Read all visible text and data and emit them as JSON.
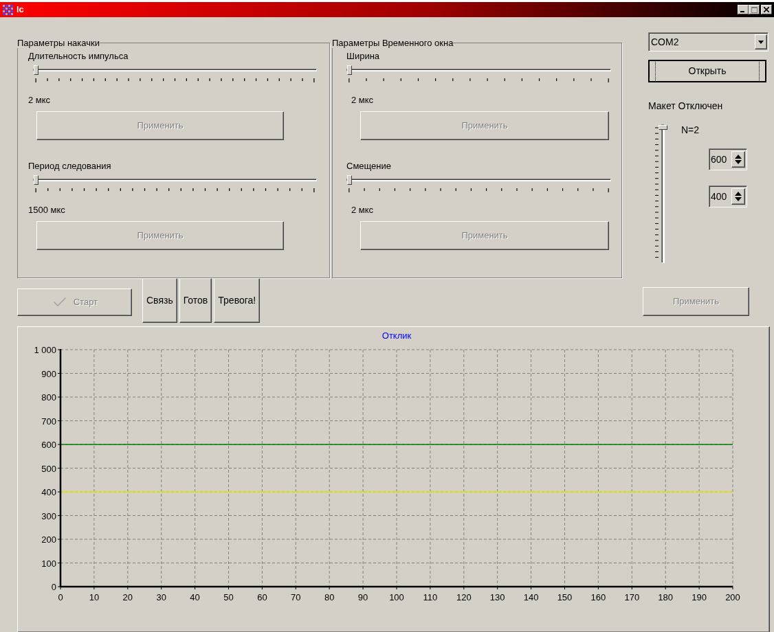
{
  "window": {
    "title": "lc"
  },
  "groups": [
    {
      "title": "Параметры накачки",
      "controls": [
        {
          "label": "Длительность импульса",
          "level": 0,
          "reading": "2 мкс",
          "button": {
            "label": "Применить",
            "disabled": true
          }
        },
        {
          "label": "Период следования",
          "level": 0,
          "reading": "1500 мкс",
          "button": {
            "label": "Применить",
            "disabled": true
          }
        }
      ]
    },
    {
      "title": "Параметры Временного окна",
      "controls": [
        {
          "label": "Ширина",
          "level": 0,
          "reading": "2 мкс",
          "button": {
            "label": "Применить",
            "disabled": true
          }
        },
        {
          "label": "Смещение",
          "level": 0,
          "reading": "2 мкс",
          "button": {
            "label": "Применить",
            "disabled": true
          }
        }
      ]
    }
  ],
  "port": {
    "value": "COM2"
  },
  "open_button": {
    "label": "Открыть",
    "disabled": false
  },
  "status_text": "Макет Отключен",
  "n_slider": {
    "level": 0,
    "reading": "N=2"
  },
  "spinners": [
    {
      "value": "600"
    },
    {
      "value": "400"
    }
  ],
  "apply_button": {
    "label": "Применить",
    "disabled": true
  },
  "start_button": {
    "label": "Старт",
    "disabled": true
  },
  "indicators": [
    {
      "label": "Связь"
    },
    {
      "label": "Готов"
    },
    {
      "label": "Тревога!"
    }
  ],
  "chart": {
    "chart_data": {
      "type": "line",
      "grid": true,
      "title": "Отклик",
      "x": [
        0,
        200
      ],
      "xlim": [
        0,
        200
      ],
      "ylim": [
        0,
        1000
      ],
      "xticks": [
        0,
        10,
        20,
        30,
        40,
        50,
        60,
        70,
        80,
        90,
        100,
        110,
        120,
        130,
        140,
        150,
        160,
        170,
        180,
        190,
        200
      ],
      "yticks": [
        0,
        100,
        200,
        300,
        400,
        500,
        600,
        700,
        800,
        900,
        {
          "value": 1000,
          "label": "1 000"
        }
      ],
      "series": [
        {
          "color": "#008000",
          "values": [
            600,
            600
          ]
        },
        {
          "color": "#e6e600",
          "values": [
            400,
            400
          ]
        }
      ]
    }
  }
}
